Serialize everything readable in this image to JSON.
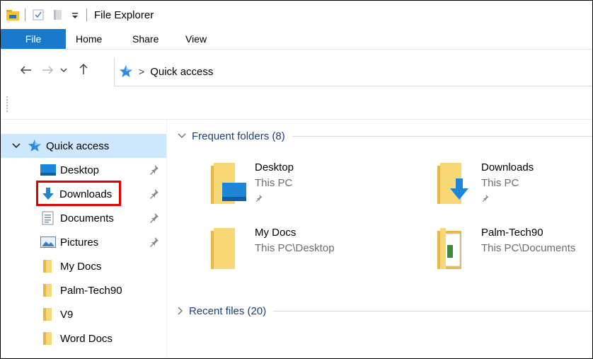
{
  "window": {
    "title": "File Explorer"
  },
  "ribbon": {
    "tabs": [
      {
        "label": "File"
      },
      {
        "label": "Home"
      },
      {
        "label": "Share"
      },
      {
        "label": "View"
      }
    ]
  },
  "address": {
    "crumb": "Quick access"
  },
  "nav": {
    "quick_access": "Quick access",
    "items": [
      {
        "label": "Desktop",
        "pinned": true,
        "icon": "desktop-icon"
      },
      {
        "label": "Downloads",
        "pinned": true,
        "icon": "download-arrow-icon"
      },
      {
        "label": "Documents",
        "pinned": true,
        "icon": "documents-icon"
      },
      {
        "label": "Pictures",
        "pinned": true,
        "icon": "pictures-icon"
      },
      {
        "label": "My Docs",
        "pinned": false,
        "icon": "folder-icon"
      },
      {
        "label": "Palm-Tech90",
        "pinned": false,
        "icon": "folder-icon"
      },
      {
        "label": "V9",
        "pinned": false,
        "icon": "folder-icon"
      },
      {
        "label": "Word Docs",
        "pinned": false,
        "icon": "folder-icon"
      }
    ]
  },
  "content": {
    "frequent_header": "Frequent folders (8)",
    "recent_header": "Recent files (20)",
    "tiles": [
      {
        "name": "Desktop",
        "sub": "This PC",
        "pinned": true
      },
      {
        "name": "Downloads",
        "sub": "This PC",
        "pinned": true
      },
      {
        "name": "My Docs",
        "sub": "This PC\\Desktop",
        "pinned": false
      },
      {
        "name": "Palm-Tech90",
        "sub": "This PC\\Documents",
        "pinned": false
      }
    ]
  },
  "colors": {
    "accent": "#1979ca",
    "selected": "#cce8ff",
    "folder": "#f8d775",
    "highlight": "#e00000"
  }
}
